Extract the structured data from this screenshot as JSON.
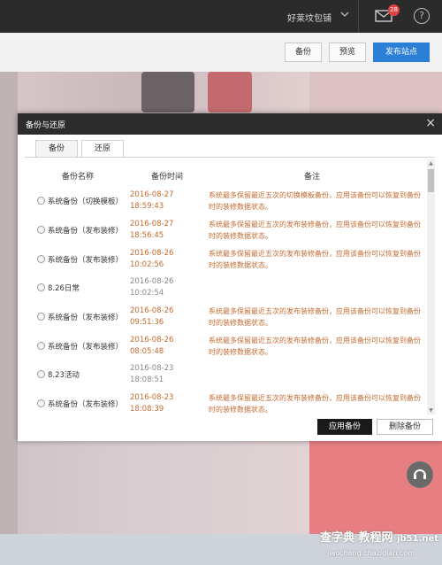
{
  "topbar": {
    "shop_name": "好莱坟包铺",
    "mail_badge": "28",
    "help_glyph": "?"
  },
  "toolbar": {
    "backup_label": "备份",
    "preview_label": "预览",
    "publish_label": "发布站点"
  },
  "modal": {
    "title": "备份与还原",
    "close_glyph": "×",
    "tabs": [
      {
        "label": "备份",
        "active": false
      },
      {
        "label": "还原",
        "active": true
      }
    ],
    "columns": {
      "name": "备份名称",
      "time": "备份时间",
      "note": "备注"
    },
    "rows": [
      {
        "name": "系统备份（切换模板）",
        "date": "2016-08-27",
        "time": "18:59:43",
        "note": "系统最多保留最近五次的切换模板备份，应用该备份可以恢复到备份时的装修数据状态。",
        "highlight": true
      },
      {
        "name": "系统备份（发布装修）",
        "date": "2016-08-27",
        "time": "18:56:45",
        "note": "系统最多保留最近五次的发布装修备份，应用该备份可以恢复到备份时的装修数据状态。",
        "highlight": true
      },
      {
        "name": "系统备份（发布装修）",
        "date": "2016-08-26",
        "time": "10:02:56",
        "note": "系统最多保留最近五次的发布装修备份，应用该备份可以恢复到备份时的装修数据状态。",
        "highlight": true
      },
      {
        "name": "8.26日常",
        "date": "2016-08-26",
        "time": "10:02:54",
        "note": "",
        "highlight": false
      },
      {
        "name": "系统备份（发布装修）",
        "date": "2016-08-26",
        "time": "09:51:36",
        "note": "系统最多保留最近五次的发布装修备份，应用该备份可以恢复到备份时的装修数据状态。",
        "highlight": true
      },
      {
        "name": "系统备份（发布装修）",
        "date": "2016-08-26",
        "time": "08:05:48",
        "note": "系统最多保留最近五次的发布装修备份，应用该备份可以恢复到备份时的装修数据状态。",
        "highlight": true
      },
      {
        "name": "8.23活动",
        "date": "2016-08-23",
        "time": "18:08:51",
        "note": "",
        "highlight": false
      },
      {
        "name": "系统备份（发布装修）",
        "date": "2016-08-23",
        "time": "18:08:39",
        "note": "系统最多保留最近五次的发布装修备份，应用该备份可以恢复到备份时的装修数据状态。",
        "highlight": true
      }
    ],
    "apply_label": "应用备份",
    "delete_label": "删除备份"
  },
  "watermark": {
    "line1": "查字典 教程网",
    "line2": "jiaocheng.chazidian.com",
    "site": "jb51.net"
  },
  "colors": {
    "accent": "#2b7fd6",
    "highlight_text": "#c26a30",
    "header_bg": "#2c2c2c"
  }
}
